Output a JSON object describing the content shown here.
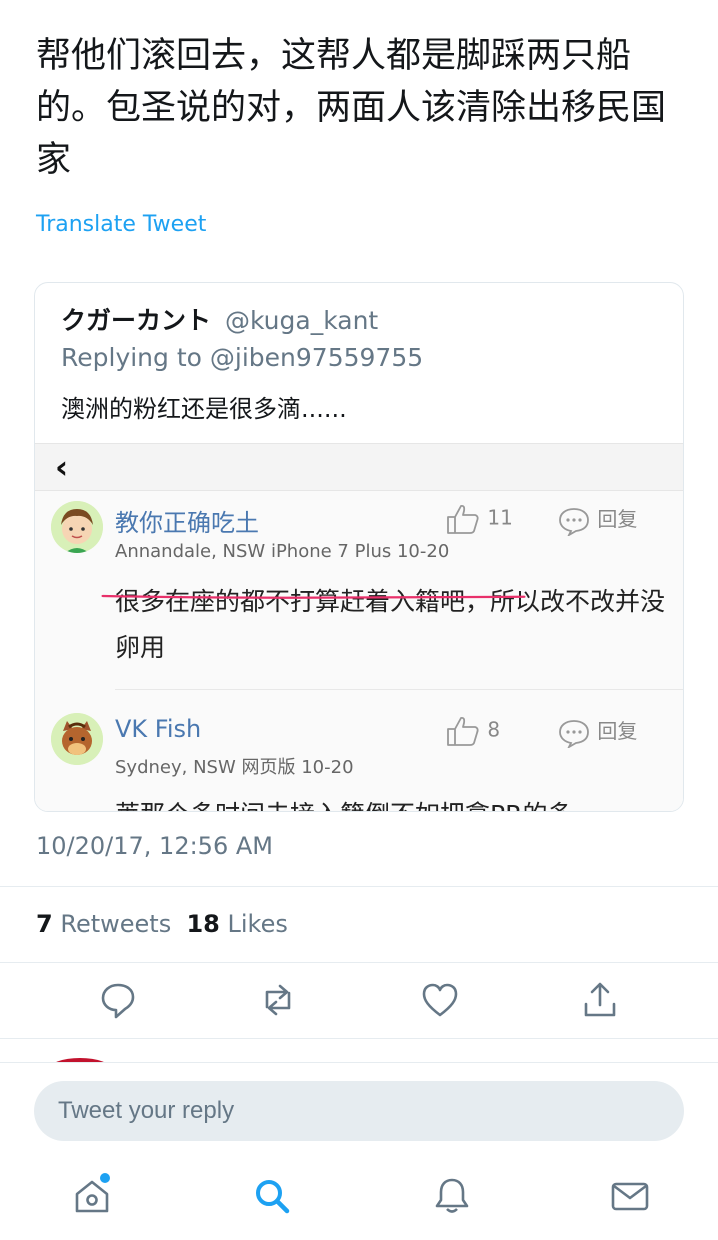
{
  "tweet": {
    "text": "帮他们滚回去，这帮人都是脚踩两只船的。包圣说的对，两面人该清除出移民国家",
    "translate_label": "Translate Tweet",
    "timestamp": "10/20/17, 12:56 AM",
    "retweets_count": "7",
    "retweets_label": "Retweets",
    "likes_count": "18",
    "likes_label": "Likes"
  },
  "quoted": {
    "name": "クガーカント",
    "handle": "@kuga_kant",
    "replying_prefix": "Replying to",
    "replying_to": "@jiben97559755",
    "text": "澳洲的粉红还是很多滴......",
    "embedded": {
      "back_glyph": "‹",
      "comments": [
        {
          "username": "教你正确吃土",
          "meta": "Annandale, NSW  iPhone 7 Plus  10-20",
          "likes": "11",
          "reply_label": "回复",
          "body": "很多在座的都不打算赶着入籍吧，所以改不改并没卵用"
        },
        {
          "username": "VK Fish",
          "meta": "Sydney, NSW  网页版  10-20",
          "likes": "8",
          "reply_label": "回复",
          "body_cut": "莱那个多时间去接入籍倒不如把拿PR的多"
        }
      ]
    }
  },
  "reply_box": {
    "placeholder": "Tweet your reply"
  },
  "colors": {
    "accent": "#1da1f2",
    "underline": "#e8306a",
    "secondary_text": "#657786"
  },
  "icons": {
    "actions": [
      "reply-icon",
      "retweet-icon",
      "like-icon",
      "share-icon"
    ],
    "nav": [
      "home-icon",
      "search-icon",
      "notifications-icon",
      "messages-icon"
    ]
  }
}
